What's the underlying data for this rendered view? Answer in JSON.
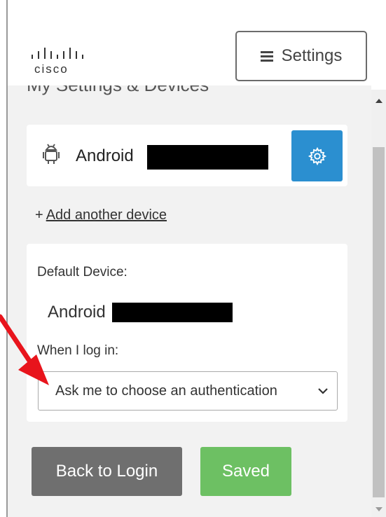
{
  "header": {
    "logo_text": "cisco",
    "settings_label": "Settings"
  },
  "page": {
    "title": "My Settings & Devices"
  },
  "device_card": {
    "device_name": "Android"
  },
  "add_device": {
    "plus": "+",
    "link_label": "Add another device"
  },
  "default_panel": {
    "default_label": "Default Device:",
    "default_value": "Android",
    "login_label": "When I log in:",
    "auth_option": "Ask me to choose an authentication"
  },
  "actions": {
    "back_label": "Back to Login",
    "saved_label": "Saved"
  },
  "colors": {
    "gear_button": "#2b8fd0",
    "saved_button": "#6dc063",
    "back_button": "#6f6f6f",
    "annotation_arrow": "#e8141c"
  },
  "icons": {
    "menu": "hamburger-icon",
    "device": "android-icon",
    "device_settings": "gear-icon",
    "select": "chevron-down-icon"
  }
}
